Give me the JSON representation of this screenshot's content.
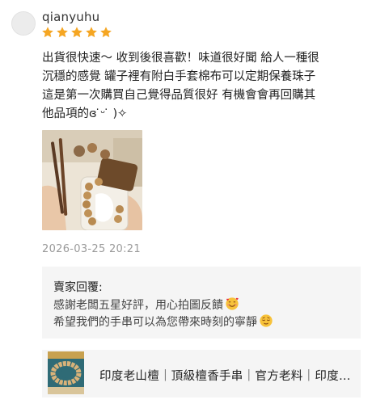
{
  "review": {
    "username": "qianyuhu",
    "rating": 5,
    "rating_max": 5,
    "star_color": "#f5a623",
    "body": "出貨很快速～ 收到後很喜歡！味道很好聞 給人一種很\n沉穩的感覺 罐子裡有附白手套棉布可以定期保養珠子\n這是第一次購買自己覺得品質很好 有機會會再回購其\n他品項的ɞ ̇ᵕ ̇ )✧",
    "timestamp": "2026-03-25 20:21"
  },
  "seller_reply": {
    "title": "賣家回覆:",
    "line1": "感謝老闆五星好評，用心拍圖反饋",
    "line1_emoji": "smiling-face-with-hearts-icon",
    "line2": "希望我們的手串可以為您帶來時刻的寧靜",
    "line2_emoji": "relieved-face-icon"
  },
  "product": {
    "name": "印度老山檀｜頂級檀香手串｜官方老料｜印度老山檀香"
  }
}
